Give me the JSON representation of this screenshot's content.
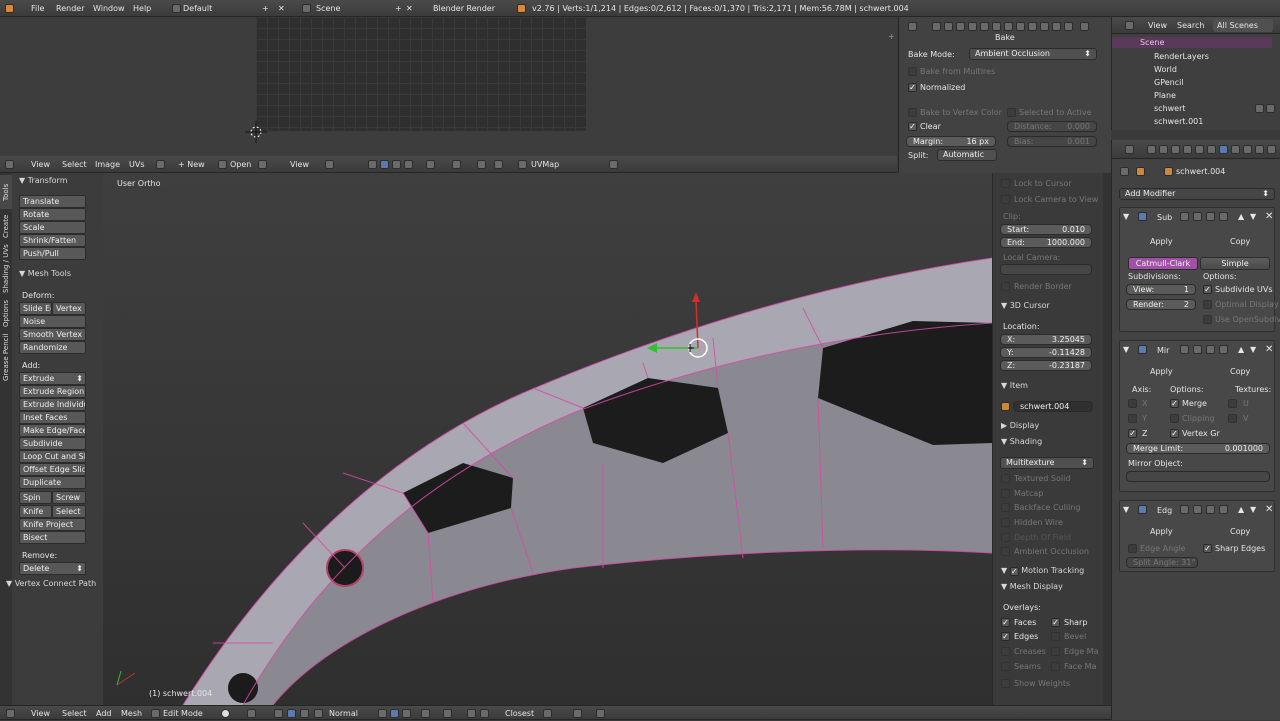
{
  "topbar": {
    "menus": [
      "File",
      "Render",
      "Window",
      "Help"
    ],
    "layout": "Default",
    "scene": "Scene",
    "engine": "Blender Render",
    "stats": "v2.76 | Verts:1/1,214 | Edges:0/2,612 | Faces:0/1,370 | Tris:2,171 | Mem:56.78M | schwert.004"
  },
  "uv_header": {
    "menus": [
      "View",
      "Select",
      "Image",
      "UVs"
    ],
    "new_label": "New",
    "open_label": "Open",
    "view_label": "View",
    "uvmap": "UVMap"
  },
  "bake": {
    "title": "Bake",
    "mode_label": "Bake Mode:",
    "mode_value": "Ambient Occlusion",
    "from_multires": "Bake from Multires",
    "normalized": "Normalized",
    "to_vertex_color": "Bake to Vertex Color",
    "selected_to_active": "Selected to Active",
    "clear": "Clear",
    "distance_label": "Distance:",
    "distance_value": "0.000",
    "margin_label": "Margin:",
    "margin_value": "16 px",
    "bias_label": "Bias:",
    "bias_value": "0.001",
    "split_label": "Split:",
    "split_value": "Automatic"
  },
  "outliner": {
    "menus": [
      "View",
      "Search"
    ],
    "filter": "All Scenes",
    "items": [
      "Scene",
      "RenderLayers",
      "World",
      "GPencil",
      "Plane",
      "schwert",
      "schwert.001"
    ]
  },
  "tool_shelf": {
    "tabs": [
      "Tools",
      "Create",
      "Shading / UVs",
      "Options",
      "Grease Pencil"
    ],
    "transform_title": "Transform",
    "transform": [
      "Translate",
      "Rotate",
      "Scale",
      "Shrink/Fatten",
      "Push/Pull"
    ],
    "mesh_tools_title": "Mesh Tools",
    "deform_label": "Deform:",
    "slide_edge": "Slide Ed",
    "vertex": "Vertex",
    "deform": [
      "Noise",
      "Smooth Vertex",
      "Randomize"
    ],
    "add_label": "Add:",
    "extrude": "Extrude",
    "add": [
      "Extrude Region",
      "Extrude Individual",
      "Inset Faces",
      "Make Edge/Face",
      "Subdivide",
      "Loop Cut and Slide",
      "Offset Edge Slide",
      "Duplicate"
    ],
    "spin": "Spin",
    "screw": "Screw",
    "knife": "Knife",
    "select": "Select",
    "knife_project": "Knife Project",
    "bisect": "Bisect",
    "remove_label": "Remove:",
    "delete": "Delete",
    "last_op": "Vertex Connect Path"
  },
  "viewport": {
    "view_name": "User Ortho",
    "object_label": "(1) schwert.004"
  },
  "properties_n": {
    "lock_to_cursor": "Lock to Cursor",
    "lock_camera": "Lock Camera to View",
    "clip_label": "Clip:",
    "start_label": "Start:",
    "start_value": "0.010",
    "end_label": "End:",
    "end_value": "1000.000",
    "local_camera": "Local Camera:",
    "render_border": "Render Border",
    "cursor_title": "3D Cursor",
    "location_label": "Location:",
    "x_label": "X:",
    "x_value": "3.25045",
    "y_label": "Y:",
    "y_value": "-0.11428",
    "z_label": "Z:",
    "z_value": "-0.23187",
    "item_title": "Item",
    "item_name": "schwert.004",
    "display_title": "Display",
    "shading_title": "Shading",
    "shading_mode": "Multitexture",
    "shading_opts": [
      "Textured Solid",
      "Matcap",
      "Backface Culling",
      "Hidden Wire",
      "Depth Of Field",
      "Ambient Occlusion"
    ],
    "motion_tracking": "Motion Tracking",
    "mesh_display_title": "Mesh Display",
    "overlays_label": "Overlays:",
    "faces": "Faces",
    "sharp": "Sharp",
    "edges": "Edges",
    "bevel": "Bevel",
    "creases": "Creases",
    "edge_marks": "Edge Ma",
    "seams": "Seams",
    "face_marks": "Face Ma",
    "show_weights": "Show Weights"
  },
  "modifiers": {
    "object_name": "schwert.004",
    "add_modifier": "Add Modifier",
    "apply": "Apply",
    "copy": "Copy",
    "subsurf": {
      "name": "Sub",
      "catmull": "Catmull-Clark",
      "simple": "Simple",
      "subdivisions_label": "Subdivisions:",
      "options_label": "Options:",
      "view_label": "View:",
      "view_value": "1",
      "render_label": "Render:",
      "render_value": "2",
      "subdivide_uvs": "Subdivide UVs",
      "optimal_display": "Optimal Display",
      "use_opensubdiv": "Use OpenSubdiv"
    },
    "mirror": {
      "name": "Mir",
      "axis_label": "Axis:",
      "options_label": "Options:",
      "textures_label": "Textures:",
      "x": "X",
      "y": "Y",
      "z": "Z",
      "merge": "Merge",
      "clipping": "Clipping",
      "vertex_gr": "Vertex Gr",
      "u": "U",
      "v": "V",
      "merge_limit_label": "Merge Limit:",
      "merge_limit_value": "0.001000",
      "mirror_object": "Mirror Object:"
    },
    "edgesplit": {
      "name": "Edg",
      "edge_angle": "Edge Angle",
      "sharp_edges": "Sharp Edges",
      "split_angle": "Split Angle: 31°"
    }
  },
  "bottom_header": {
    "menus": [
      "View",
      "Select",
      "Add",
      "Mesh"
    ],
    "mode": "Edit Mode",
    "pivot": "Normal",
    "snap": "Closest"
  }
}
